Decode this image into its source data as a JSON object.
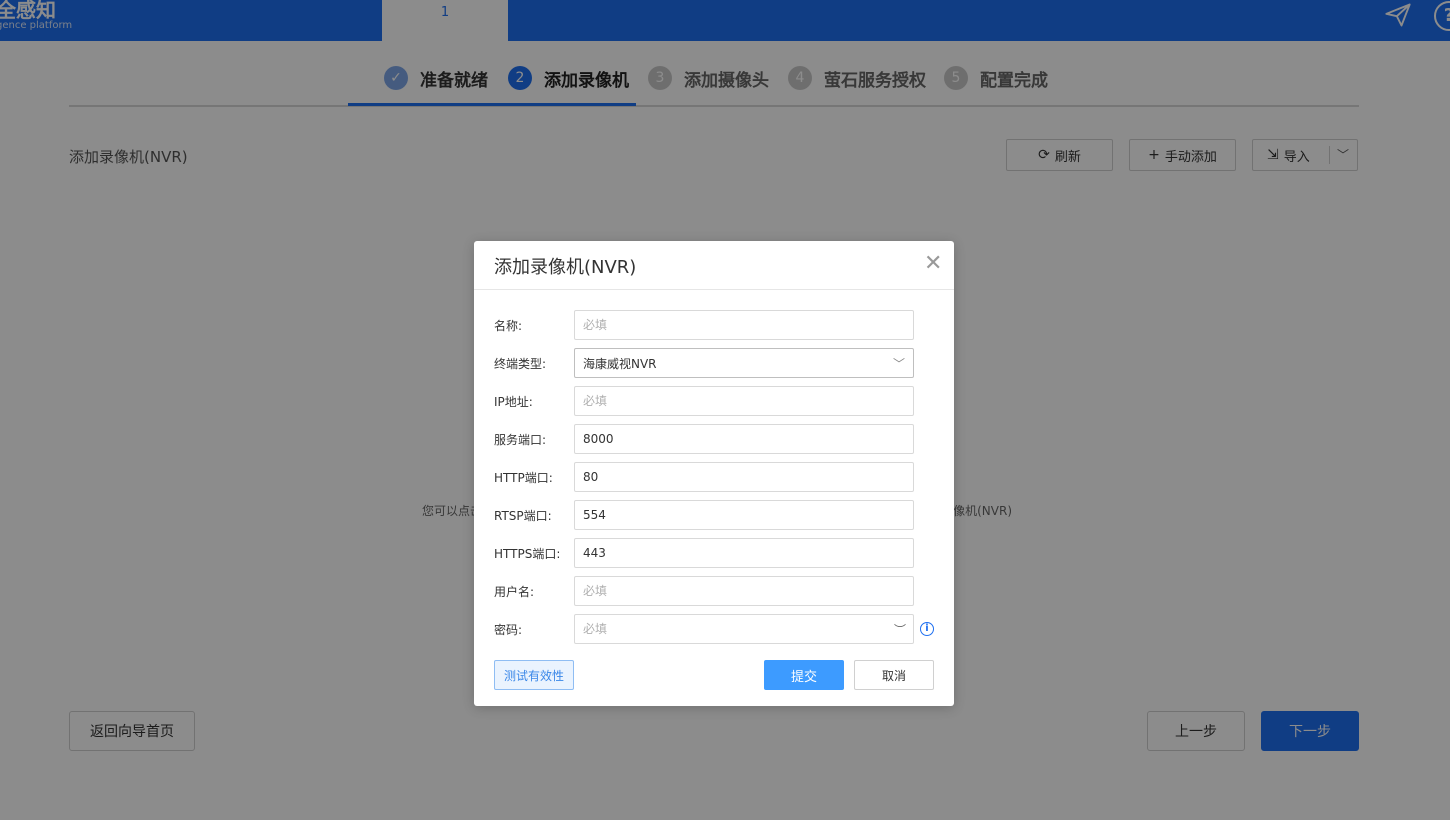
{
  "header": {
    "logo_title": "全感知",
    "logo_sub": "gence platform",
    "tab_label": "1",
    "icons": [
      "send-icon",
      "help-icon"
    ]
  },
  "steps": [
    {
      "num": "✓",
      "label": "准备就绪",
      "state": "done"
    },
    {
      "num": "2",
      "label": "添加录像机",
      "state": "active"
    },
    {
      "num": "3",
      "label": "添加摄像头",
      "state": "todo"
    },
    {
      "num": "4",
      "label": "萤石服务授权",
      "state": "todo"
    },
    {
      "num": "5",
      "label": "配置完成",
      "state": "todo"
    }
  ],
  "section": {
    "title": "添加录像机(NVR)",
    "refresh_label": "刷新",
    "manual_add_label": "手动添加",
    "import_label": "导入"
  },
  "empty": {
    "hint_left": "您可以点击",
    "hint_right": "像机(NVR)"
  },
  "footer": {
    "home_label": "返回向导首页",
    "prev_label": "上一步",
    "next_label": "下一步"
  },
  "dialog": {
    "title": "添加录像机(NVR)",
    "fields": {
      "name": {
        "label": "名称:",
        "value": "",
        "placeholder": "必填"
      },
      "type": {
        "label": "终端类型:",
        "value": "海康威视NVR"
      },
      "ip": {
        "label": "IP地址:",
        "value": "",
        "placeholder": "必填"
      },
      "service_port": {
        "label": "服务端口:",
        "value": "8000"
      },
      "http_port": {
        "label": "HTTP端口:",
        "value": "80"
      },
      "rtsp_port": {
        "label": "RTSP端口:",
        "value": "554"
      },
      "https_port": {
        "label": "HTTPS端口:",
        "value": "443"
      },
      "username": {
        "label": "用户名:",
        "value": "",
        "placeholder": "必填"
      },
      "password": {
        "label": "密码:",
        "value": "",
        "placeholder": "必填"
      }
    },
    "test_label": "测试有效性",
    "submit_label": "提交",
    "cancel_label": "取消"
  },
  "colors": {
    "primary": "#1e6ff0",
    "submit": "#3d9bff"
  }
}
